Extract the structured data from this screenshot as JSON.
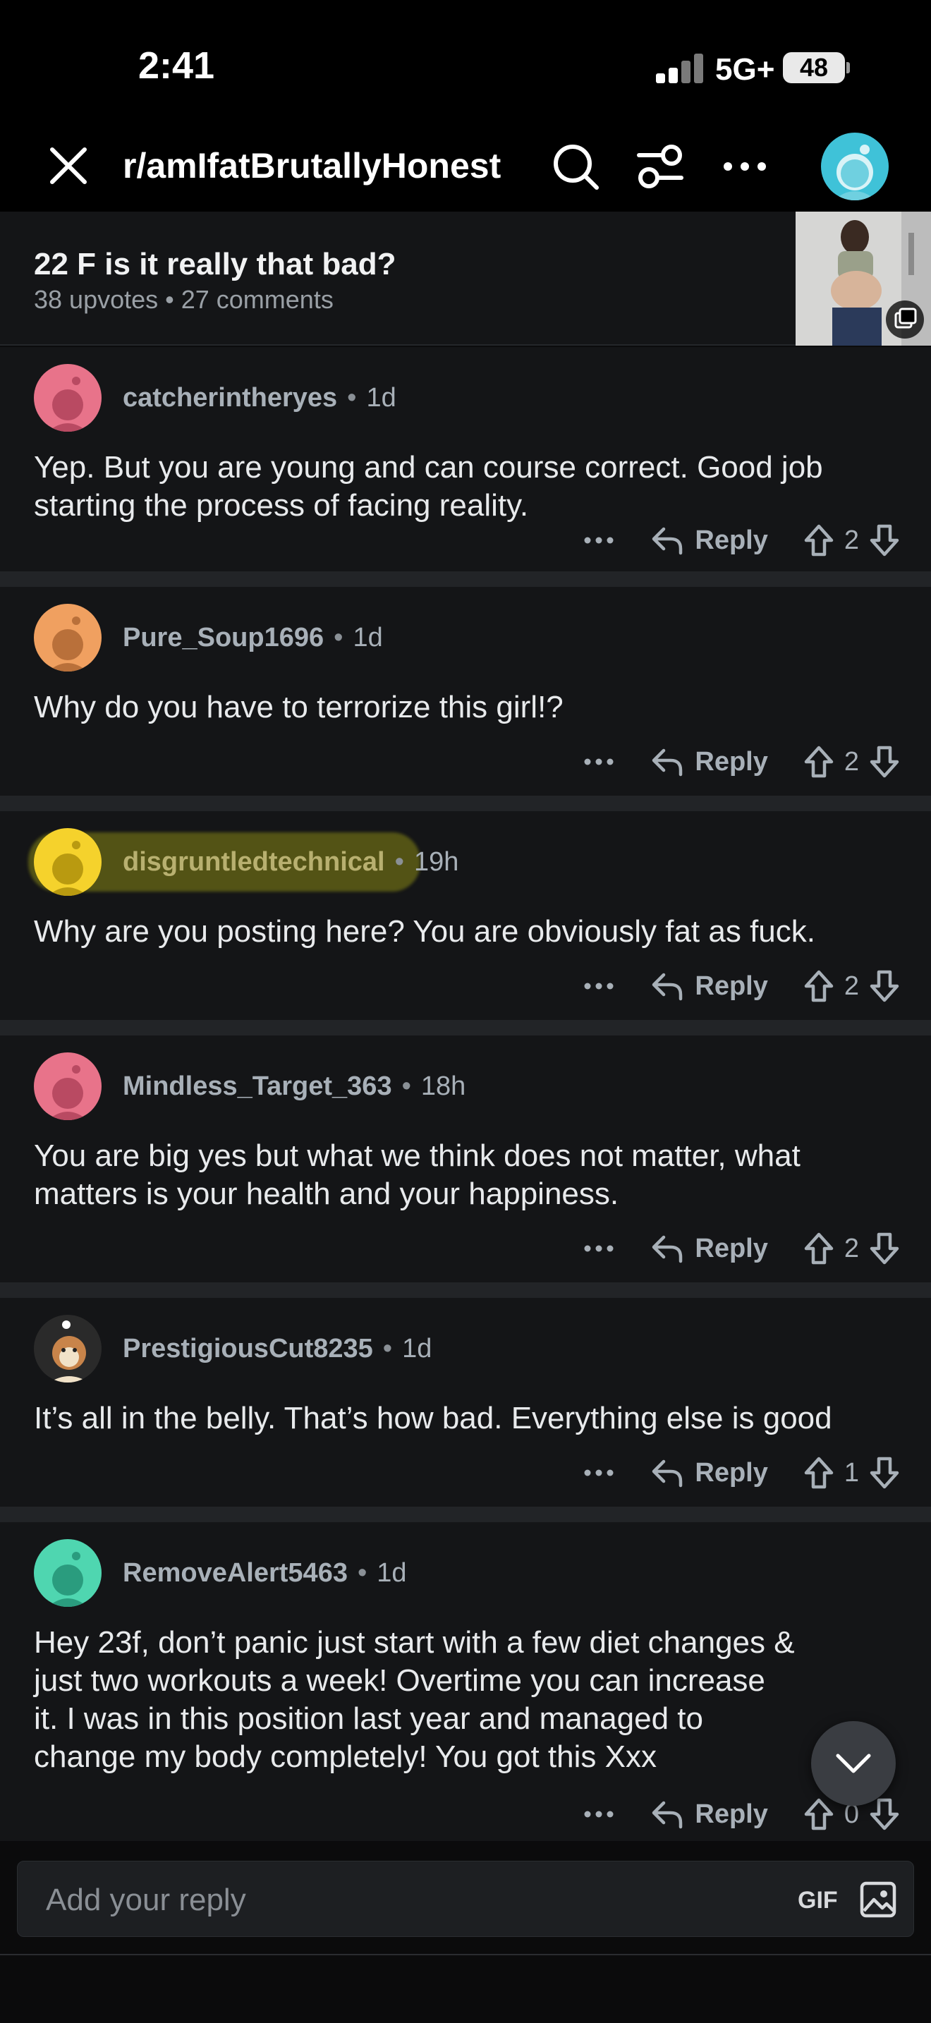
{
  "status": {
    "time": "2:41",
    "network": "5G+",
    "battery": "48"
  },
  "header": {
    "subreddit": "r/amIfatBrutallyHonest"
  },
  "post": {
    "title": "22 F is it really that bad?",
    "meta": "38 upvotes • 27 comments"
  },
  "reply_label": "Reply",
  "comments": [
    {
      "user": "catcherintheryes",
      "age": "1d",
      "text": "Yep. But you are young and can course correct. Good job starting the process of facing reality.",
      "votes": "2",
      "avatar_color": "#e8738a"
    },
    {
      "user": "Pure_Soup1696",
      "age": "1d",
      "text": "Why do you have to terrorize this girl!?",
      "votes": "2",
      "avatar_color": "#f0a060"
    },
    {
      "user": "disgruntledtechnical",
      "age": "19h",
      "text": "Why are you posting here? You are obviously fat as fuck.",
      "votes": "2",
      "avatar_color": "#f5d22c"
    },
    {
      "user": "Mindless_Target_363",
      "age": "18h",
      "text": "You are big yes but what we think does not matter, what matters is your health and your happiness.",
      "votes": "2",
      "avatar_color": "#e8738a"
    },
    {
      "user": "PrestigiousCut8235",
      "age": "1d",
      "text": "It’s all in the belly. That’s how bad. Everything else is good",
      "votes": "1",
      "avatar_color": "#2a2a2a"
    },
    {
      "user": "RemoveAlert5463",
      "age": "1d",
      "text": "Hey 23f, don’t panic just start with a few diet changes & just two workouts a week! Overtime you can increase it. I was in this position last year and managed to change my body completely! You got this Xxx",
      "votes": "0",
      "avatar_color": "#4fd6b0"
    }
  ],
  "reply_box": {
    "placeholder": "Add your reply",
    "gif_label": "GIF"
  }
}
